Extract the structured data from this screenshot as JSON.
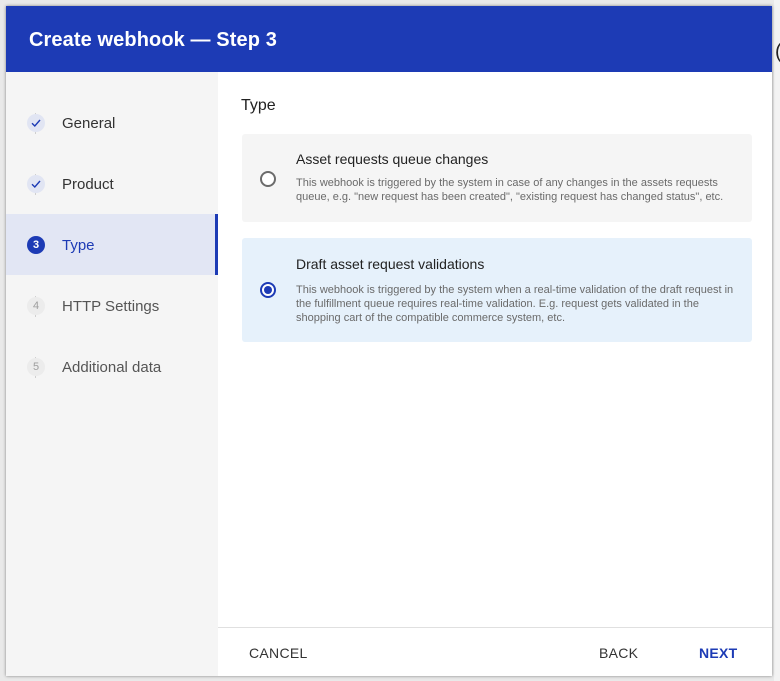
{
  "dialog": {
    "title": "Create webhook — Step 3"
  },
  "background": {
    "edge_glyph": "("
  },
  "steps": [
    {
      "label": "General",
      "status": "done",
      "icon": "check-icon"
    },
    {
      "label": "Product",
      "status": "done",
      "icon": "check-icon"
    },
    {
      "label": "Type",
      "number": "3",
      "status": "active"
    },
    {
      "label": "HTTP Settings",
      "number": "4",
      "status": "pending"
    },
    {
      "label": "Additional data",
      "number": "5",
      "status": "pending"
    }
  ],
  "main": {
    "section_title": "Type",
    "options": [
      {
        "title": "Asset requests queue changes",
        "description": "This webhook is triggered by the system in case of any changes in the assets requests queue, e.g. \"new request has been created\", \"existing request has changed status\", etc.",
        "selected": false
      },
      {
        "title": "Draft asset request validations",
        "description": "This webhook is triggered by the system when a real-time validation of the draft request in the fulfillment queue requires real-time validation. E.g. request gets validated in the shopping cart of the compatible commerce system, etc.",
        "selected": true
      }
    ]
  },
  "footer": {
    "cancel_label": "CANCEL",
    "back_label": "BACK",
    "next_label": "NEXT"
  },
  "colors": {
    "primary": "#1d3bb5",
    "selected_option_bg": "#e6f1fb",
    "sidebar_bg": "#f5f5f5"
  }
}
